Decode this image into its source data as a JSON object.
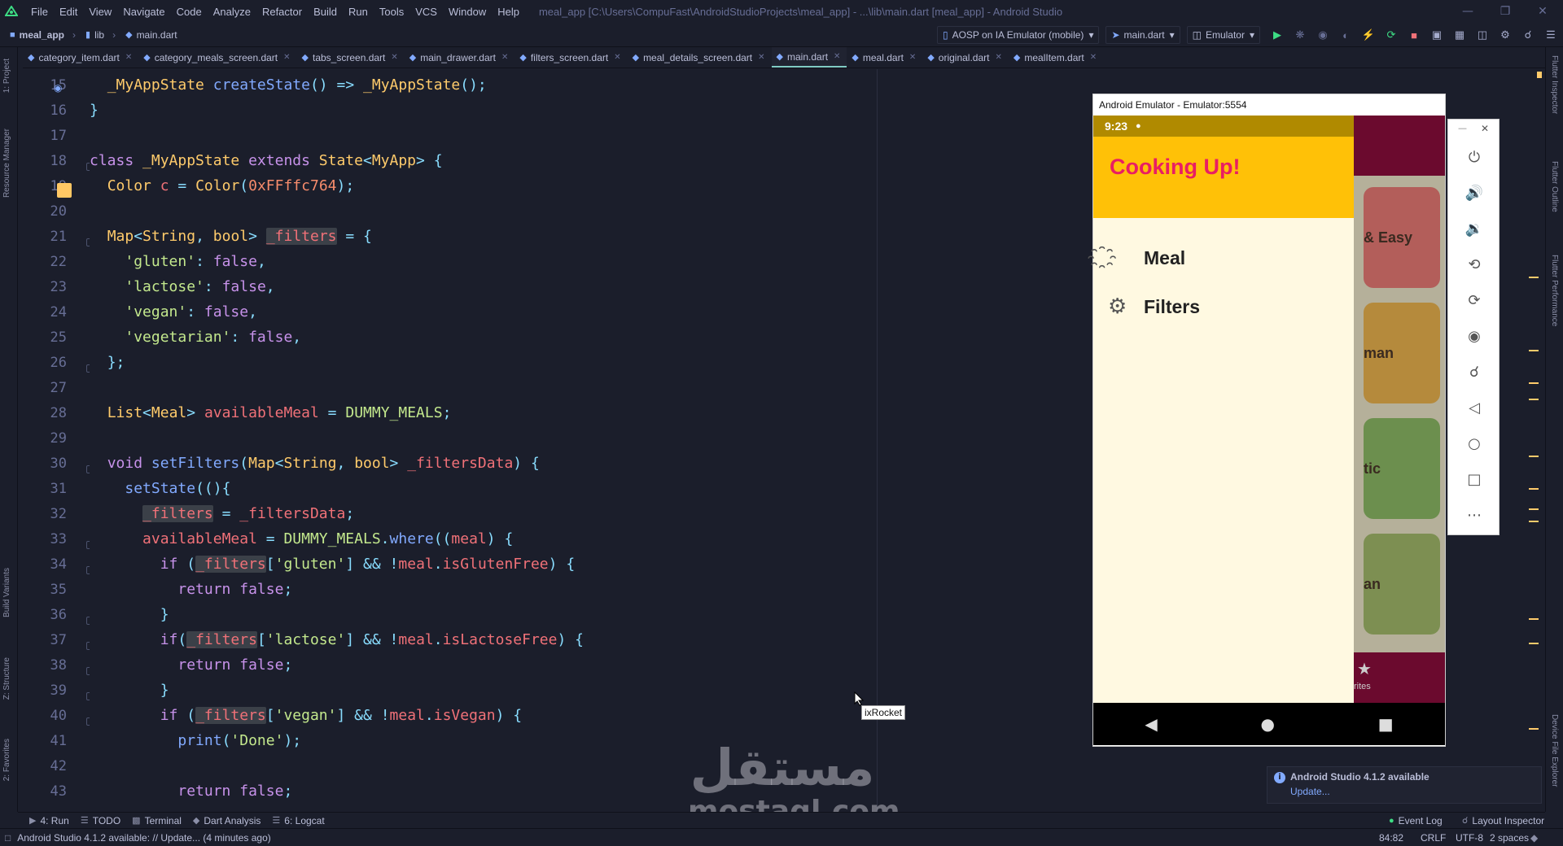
{
  "app": {
    "menus": [
      "File",
      "Edit",
      "View",
      "Navigate",
      "Code",
      "Analyze",
      "Refactor",
      "Build",
      "Run",
      "Tools",
      "VCS",
      "Window",
      "Help"
    ],
    "window_title": "meal_app [C:\\Users\\CompuFast\\AndroidStudioProjects\\meal_app] - ...\\lib\\main.dart [meal_app] - Android Studio"
  },
  "breadcrumb": {
    "project": "meal_app",
    "folder": "lib",
    "file": "main.dart"
  },
  "toolbar": {
    "device": "AOSP on IA Emulator (mobile)",
    "run_config": "main.dart",
    "emulator": "Emulator"
  },
  "tabs": [
    {
      "label": "category_item.dart"
    },
    {
      "label": "category_meals_screen.dart"
    },
    {
      "label": "tabs_screen.dart"
    },
    {
      "label": "main_drawer.dart"
    },
    {
      "label": "filters_screen.dart"
    },
    {
      "label": "meal_details_screen.dart"
    },
    {
      "label": "main.dart"
    },
    {
      "label": "meal.dart"
    },
    {
      "label": "original.dart"
    },
    {
      "label": "mealItem.dart"
    }
  ],
  "left_tools": {
    "project": "1: Project",
    "resource": "Resource Manager",
    "build_variants": "Build Variants",
    "structure": "Z: Structure",
    "favorites": "2: Favorites"
  },
  "right_tools": {
    "inspector": "Flutter Inspector",
    "outline": "Flutter Outline",
    "performance": "Flutter Performance",
    "device_explorer": "Device File Explorer"
  },
  "line_numbers": [
    "15",
    "16",
    "17",
    "18",
    "19",
    "20",
    "21",
    "22",
    "23",
    "24",
    "25",
    "26",
    "27",
    "28",
    "29",
    "30",
    "31",
    "32",
    "33",
    "34",
    "35",
    "36",
    "37",
    "38",
    "39",
    "40",
    "41",
    "42",
    "43"
  ],
  "code_lines": [
    "  _MyAppState createState() => _MyAppState();",
    "}",
    "",
    "class _MyAppState extends State<MyApp> {",
    "  Color c = Color(0xFFffc764);",
    "",
    "  Map<String, bool> _filters = {",
    "    'gluten': false,",
    "    'lactose': false,",
    "    'vegan': false,",
    "    'vegetarian': false,",
    "  };",
    "",
    "  List<Meal> availableMeal = DUMMY_MEALS;",
    "",
    "  void setFilters(Map<String, bool> _filtersData) {",
    "    setState((){",
    "      _filters = _filtersData;",
    "      availableMeal = DUMMY_MEALS.where((meal) {",
    "        if (_filters['gluten'] && !meal.isGlutenFree) {",
    "          return false;",
    "        }",
    "        if(_filters['lactose'] && !meal.isLactoseFree) {",
    "          return false;",
    "        }",
    "        if (_filters['vegan'] && !meal.isVegan) {",
    "          print('Done');",
    "",
    "          return false;"
  ],
  "emulator": {
    "title": "Android Emulator - Emulator:5554",
    "time": "9:23",
    "drawer_title": "Cooking Up!",
    "drawer_items": [
      {
        "label": "Meal",
        "icon": "restaurant-icon"
      },
      {
        "label": "Filters",
        "icon": "gear-icon"
      }
    ],
    "card_fragments": [
      "& Easy",
      "man",
      "tic",
      "an"
    ],
    "bottom_fragment": "rites"
  },
  "tooltip": "ixRocket",
  "notification": {
    "title": "Android Studio 4.1.2 available",
    "link": "Update..."
  },
  "tool_windows": [
    "4: Run",
    "TODO",
    "Terminal",
    "Dart Analysis",
    "6: Logcat"
  ],
  "tool_windows_right": [
    "Event Log",
    "Layout Inspector"
  ],
  "status": {
    "message": "Android Studio 4.1.2 available: // Update... (4 minutes ago)",
    "position": "84:82",
    "line_sep": "CRLF",
    "encoding": "UTF-8",
    "indent": "2 spaces"
  },
  "watermark": {
    "arabic": "مستقل",
    "latin": "mostaql.com"
  },
  "colors": {
    "keyword": "#c792ea",
    "type": "#ffcb6b",
    "function": "#82aaff",
    "string": "#c3e88d",
    "variable": "#f07178",
    "drawer_header": "#ffc107",
    "drawer_title": "#e91e63",
    "app_bar": "#8e0b3c"
  }
}
